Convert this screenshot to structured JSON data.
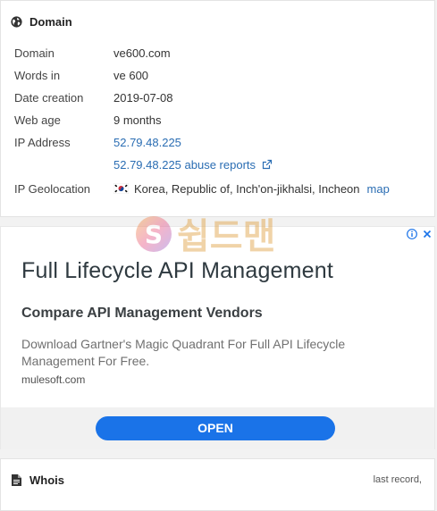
{
  "domain_card": {
    "title": "Domain",
    "rows": [
      {
        "label": "Domain",
        "value": "ve600.com"
      },
      {
        "label": "Words in",
        "value": "ve 600"
      },
      {
        "label": "Date creation",
        "value": "2019-07-08"
      },
      {
        "label": "Web age",
        "value": "9 months"
      },
      {
        "label": "IP Address",
        "value": "52.79.48.225"
      }
    ],
    "abuse_link": "52.79.48.225 abuse reports",
    "geo_label": "IP Geolocation",
    "geo_value": "Korea, Republic of, Inch'on-jikhalsi, Incheon",
    "map_link": "map"
  },
  "ad": {
    "headline": "Full Lifecycle API Management",
    "subheadline": "Compare API Management Vendors",
    "description": "Download Gartner's Magic Quadrant For Full API Lifecycle Management For Free.",
    "domain": "mulesoft.com",
    "cta": "OPEN",
    "colors": {
      "cta": "#1a73e8",
      "badge": "#1a73e8"
    }
  },
  "watermark": {
    "text": "쉽드맨"
  },
  "whois_card": {
    "title": "Whois",
    "note": "last record,"
  },
  "icons": [
    "globe-icon",
    "external-link-icon",
    "korea-flag-icon",
    "ad-info-icon",
    "ad-close-icon",
    "document-icon"
  ]
}
